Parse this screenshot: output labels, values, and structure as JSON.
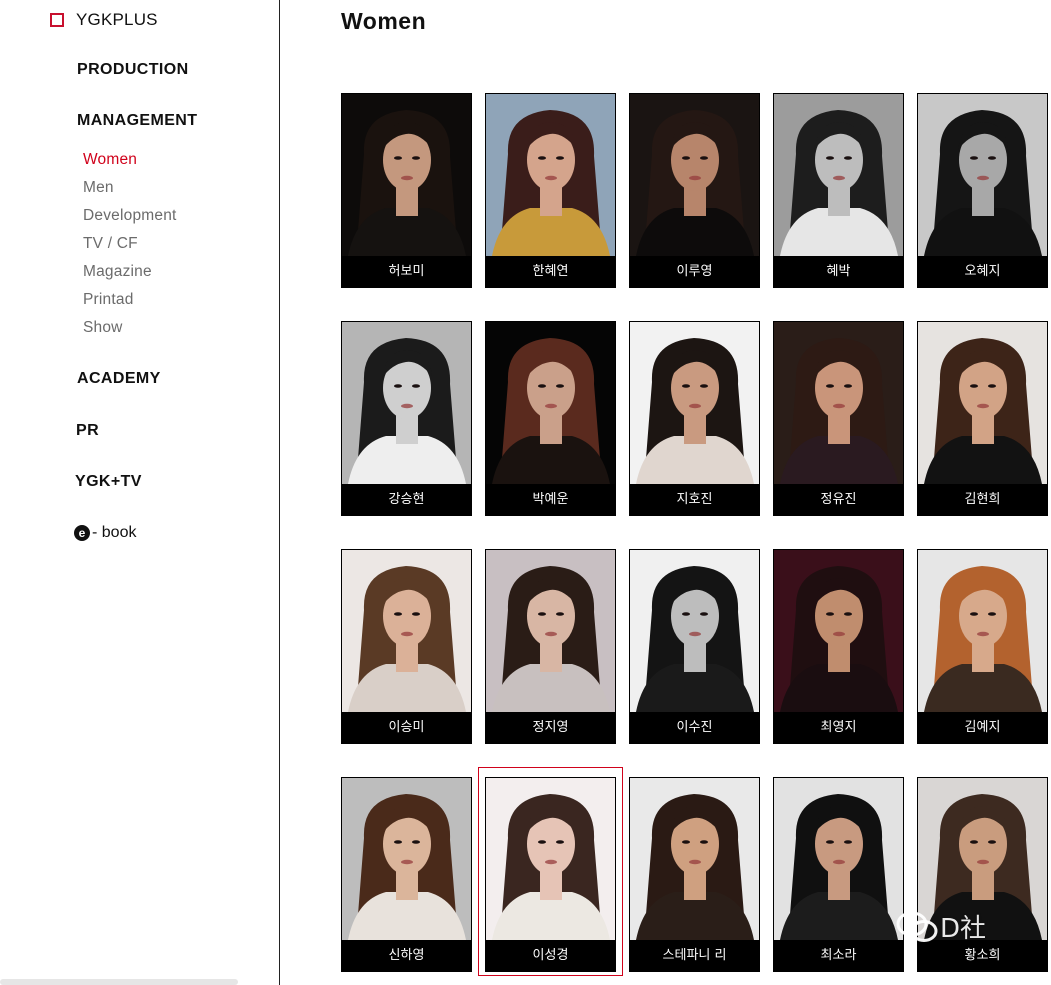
{
  "sidebar": {
    "brand": "YGKPLUS",
    "nav": {
      "production": "PRODUCTION",
      "management": "MANAGEMENT",
      "academy": "ACADEMY",
      "pr": "PR",
      "ygktv": "YGK+TV"
    },
    "sub_items": [
      "Women",
      "Men",
      "Development",
      "TV / CF",
      "Magazine",
      "Printad",
      "Show"
    ],
    "active_sub_item": "Women",
    "ebook": {
      "icon_letter": "e",
      "label": "- book",
      "icon": "e-circle-icon"
    }
  },
  "main": {
    "title": "Women",
    "models": [
      {
        "name": "허보미",
        "bg": "#0d0b0a",
        "hair": "#1a120e",
        "skin": "#c4987e",
        "clothes": "#151210"
      },
      {
        "name": "한혜연",
        "bg": "#8fa4b8",
        "hair": "#3a1d1a",
        "skin": "#d4a48c",
        "clothes": "#c89a3a"
      },
      {
        "name": "이루영",
        "bg": "#1a1412",
        "hair": "#241713",
        "skin": "#b7856b",
        "clothes": "#0d0b0b"
      },
      {
        "name": "혜박",
        "bg": "#9c9c9c",
        "hair": "#1d1d1d",
        "skin": "#bdbdbd",
        "clothes": "#e6e6e6"
      },
      {
        "name": "오혜지",
        "bg": "#c8c8c8",
        "hair": "#151515",
        "skin": "#a8a8a8",
        "clothes": "#111111"
      },
      {
        "name": "강승현",
        "bg": "#b5b5b5",
        "hair": "#1b1b1b",
        "skin": "#cfcfcf",
        "clothes": "#eeeeee"
      },
      {
        "name": "박예운",
        "bg": "#050505",
        "hair": "#5a2a1e",
        "skin": "#caa08a",
        "clothes": "#1a120f"
      },
      {
        "name": "지호진",
        "bg": "#f2f2f2",
        "hair": "#1c1512",
        "skin": "#c99a80",
        "clothes": "#e0d6cf"
      },
      {
        "name": "정유진",
        "bg": "#2a1d18",
        "hair": "#2d1a14",
        "skin": "#c9957a",
        "clothes": "#2a1a20"
      },
      {
        "name": "김현희",
        "bg": "#e6e3e0",
        "hair": "#3d2418",
        "skin": "#d2a386",
        "clothes": "#121212"
      },
      {
        "name": "이승미",
        "bg": "#ece7e4",
        "hair": "#5a3a25",
        "skin": "#dbb198",
        "clothes": "#d9cfc8"
      },
      {
        "name": "정지영",
        "bg": "#c8bfc2",
        "hair": "#2a1c16",
        "skin": "#d8b6a4",
        "clothes": "#c8c0bf"
      },
      {
        "name": "이수진",
        "bg": "#f0f0f0",
        "hair": "#141414",
        "skin": "#bdbdbd",
        "clothes": "#1a1a1a"
      },
      {
        "name": "최영지",
        "bg": "#3a0f1a",
        "hair": "#1f0e10",
        "skin": "#c08d6e",
        "clothes": "#1a0d10"
      },
      {
        "name": "김예지",
        "bg": "#e6e6e6",
        "hair": "#b3622e",
        "skin": "#d7a98b",
        "clothes": "#3a2a20"
      },
      {
        "name": "신하영",
        "bg": "#bdbdbd",
        "hair": "#4a2a1a",
        "skin": "#dbb59b",
        "clothes": "#e8e2dc"
      },
      {
        "name": "이성경",
        "bg": "#f3eeee",
        "hair": "#3a2620",
        "skin": "#e6c4b6",
        "clothes": "#ece8e2"
      },
      {
        "name": "스테파니 리",
        "bg": "#e9e9e9",
        "hair": "#2a1a14",
        "skin": "#cfa080",
        "clothes": "#2a1e18"
      },
      {
        "name": "최소라",
        "bg": "#e2e2e2",
        "hair": "#101010",
        "skin": "#c89a80",
        "clothes": "#1c1c1c"
      },
      {
        "name": "황소희",
        "bg": "#d9d6d4",
        "hair": "#3d2a20",
        "skin": "#c99c7e",
        "clothes": "#111111"
      }
    ],
    "selected_model": "이성경"
  },
  "watermark": {
    "text": "D社",
    "icon": "wechat-icon"
  }
}
